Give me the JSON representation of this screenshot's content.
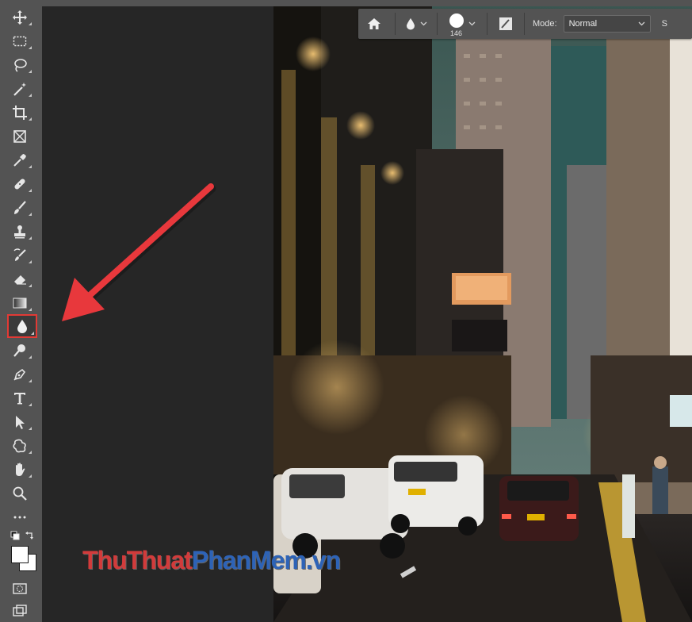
{
  "tools": [
    {
      "name": "move-tool",
      "icon": "move-icon",
      "has_corner": true
    },
    {
      "name": "rectangular-marquee-tool",
      "icon": "marquee-icon",
      "has_corner": true
    },
    {
      "name": "lasso-tool",
      "icon": "lasso-icon",
      "has_corner": true
    },
    {
      "name": "magic-wand-tool",
      "icon": "magic-wand-icon",
      "has_corner": true
    },
    {
      "name": "crop-tool",
      "icon": "crop-icon",
      "has_corner": true
    },
    {
      "name": "frame-tool",
      "icon": "frame-icon",
      "has_corner": false
    },
    {
      "name": "eyedropper-tool",
      "icon": "eyedropper-icon",
      "has_corner": true
    },
    {
      "name": "healing-brush-tool",
      "icon": "bandage-icon",
      "has_corner": true
    },
    {
      "name": "brush-tool",
      "icon": "brush-icon",
      "has_corner": true
    },
    {
      "name": "clone-stamp-tool",
      "icon": "stamp-icon",
      "has_corner": true
    },
    {
      "name": "history-brush-tool",
      "icon": "history-brush-icon",
      "has_corner": true
    },
    {
      "name": "eraser-tool",
      "icon": "eraser-icon",
      "has_corner": true
    },
    {
      "name": "gradient-tool",
      "icon": "gradient-icon",
      "has_corner": true
    },
    {
      "name": "blur-tool",
      "icon": "water-drop-icon",
      "has_corner": true,
      "selected": true
    },
    {
      "name": "dodge-tool",
      "icon": "dodge-icon",
      "has_corner": true
    },
    {
      "name": "pen-tool",
      "icon": "pen-icon",
      "has_corner": true
    },
    {
      "name": "type-tool",
      "icon": "type-icon",
      "has_corner": true
    },
    {
      "name": "path-selection-tool",
      "icon": "arrow-pointer-icon",
      "has_corner": true
    },
    {
      "name": "custom-shape-tool",
      "icon": "shape-icon",
      "has_corner": true
    },
    {
      "name": "hand-tool",
      "icon": "hand-icon",
      "has_corner": true
    },
    {
      "name": "zoom-tool",
      "icon": "zoom-icon",
      "has_corner": false
    },
    {
      "name": "edit-toolbar",
      "icon": "more-icon",
      "has_corner": false
    }
  ],
  "options_bar": {
    "home_icon": "home-icon",
    "tool_preset_icon": "water-drop-icon",
    "brush_size": "146",
    "mode_label": "Mode:",
    "mode_value": "Normal",
    "strength_label_partial": "S"
  },
  "watermark": {
    "part1": "Thu",
    "part2": "Thuat",
    "part3": "Phan",
    "part4": "Mem",
    "part5": ".vn"
  },
  "colors": {
    "panel": "#535353",
    "canvas": "#262626",
    "highlight": "#e23a35",
    "arrow": "#e8383c"
  }
}
